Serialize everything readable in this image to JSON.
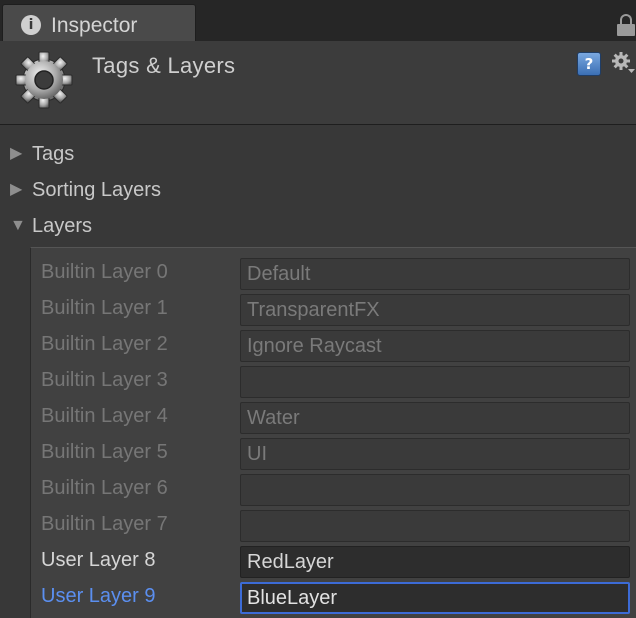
{
  "tab": {
    "icon": "info-icon",
    "label": "Inspector"
  },
  "header": {
    "icon": "gear-icon",
    "title": "Tags & Layers",
    "help_icon": "help-book-icon",
    "settings_icon": "settings-cog-icon"
  },
  "sections": [
    {
      "label": "Tags",
      "expanded": false
    },
    {
      "label": "Sorting Layers",
      "expanded": false
    },
    {
      "label": "Layers",
      "expanded": true
    }
  ],
  "layers": [
    {
      "label": "Builtin Layer 0",
      "value": "Default",
      "builtin": true
    },
    {
      "label": "Builtin Layer 1",
      "value": "TransparentFX",
      "builtin": true
    },
    {
      "label": "Builtin Layer 2",
      "value": "Ignore Raycast",
      "builtin": true
    },
    {
      "label": "Builtin Layer 3",
      "value": "",
      "builtin": true
    },
    {
      "label": "Builtin Layer 4",
      "value": "Water",
      "builtin": true
    },
    {
      "label": "Builtin Layer 5",
      "value": "UI",
      "builtin": true
    },
    {
      "label": "Builtin Layer 6",
      "value": "",
      "builtin": true
    },
    {
      "label": "Builtin Layer 7",
      "value": "",
      "builtin": true
    },
    {
      "label": "User Layer 8",
      "value": "RedLayer",
      "builtin": false
    },
    {
      "label": "User Layer 9",
      "value": "BlueLayer",
      "builtin": false,
      "focused": true
    }
  ],
  "colors": {
    "focus_accent": "#3c6bd6",
    "focus_label": "#5b8ff0",
    "background": "#383838"
  }
}
